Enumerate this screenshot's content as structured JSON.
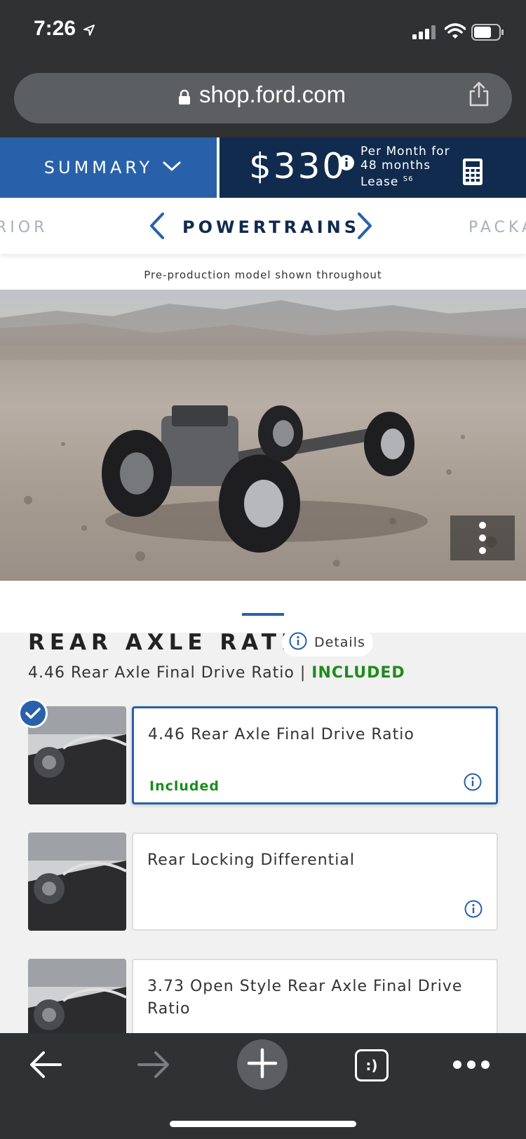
{
  "status_bar": {
    "time": "7:26"
  },
  "browser": {
    "url": "shop.ford.com",
    "tabs_label": ":)"
  },
  "header": {
    "summary_label": "SUMMARY",
    "price": "$330",
    "lease_line1": "Per Month for",
    "lease_line2": "48 months",
    "lease_line3": "Lease",
    "lease_footnote": "S6"
  },
  "category_nav": {
    "prev_partial": "RIOR",
    "current": "POWERTRAINS",
    "next_partial": "PACKA"
  },
  "disclaimer": "Pre-production model shown throughout",
  "section": {
    "title": "REAR AXLE RATIO",
    "details_label": "Details",
    "selected_summary": "4.46 Rear Axle Final Drive Ratio | ",
    "selected_price": "INCLUDED"
  },
  "options": [
    {
      "name": "4.46 Rear Axle Final Drive Ratio",
      "price": "Included",
      "selected": true
    },
    {
      "name": "Rear Locking Differential",
      "price": "",
      "selected": false
    },
    {
      "name": "3.73 Open Style Rear Axle Final Drive Ratio",
      "price": "",
      "selected": false
    }
  ],
  "colors": {
    "ford_blue": "#2861a9",
    "ford_navy": "#102b4e",
    "included_green": "#1c8c1c",
    "browser_chrome": "#2f3133"
  }
}
